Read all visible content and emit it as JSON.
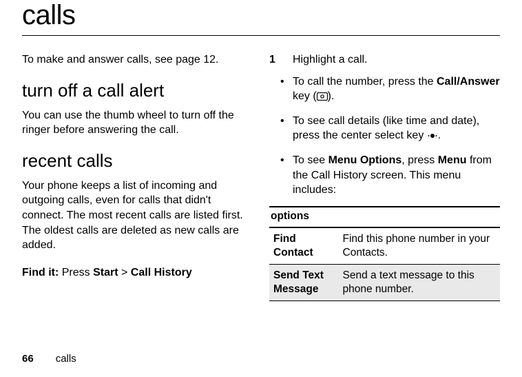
{
  "page": {
    "title": "calls",
    "footer_page_number": "66",
    "footer_label": "calls"
  },
  "left": {
    "intro": "To make and answer calls, see page 12.",
    "subhead1": "turn off a call alert",
    "turnoff_text": "You can use the thumb wheel to turn off the ringer before answering the call.",
    "subhead2": "recent calls",
    "recent_text": "Your phone keeps a list of incoming and outgoing calls, even for calls that didn't connect. The most recent calls are listed first. The oldest calls are deleted as new calls are added.",
    "find_it_label": "Find it:",
    "find_it_press": " Press ",
    "find_it_start": "Start",
    "find_it_sep": " > ",
    "find_it_callhistory": "Call History"
  },
  "right": {
    "step_num": "1",
    "step_text": "Highlight a call.",
    "bullet1_a": "To call the number, press the ",
    "bullet1_key": "Call/Answer",
    "bullet1_b": " key (",
    "bullet1_c": ").",
    "bullet2_a": "To see call details (like time and date), press the center select key ",
    "bullet2_b": ".",
    "bullet3_a": "To see ",
    "bullet3_menu": "Menu Options",
    "bullet3_b": ", press ",
    "bullet3_menu2": "Menu",
    "bullet3_c": " from the Call History screen. This menu includes:",
    "options_header": "options",
    "rows": [
      {
        "name": "Find Contact",
        "desc": "Find this phone number in your Contacts."
      },
      {
        "name": "Send Text Message",
        "desc": "Send a text message to this phone number."
      }
    ]
  }
}
